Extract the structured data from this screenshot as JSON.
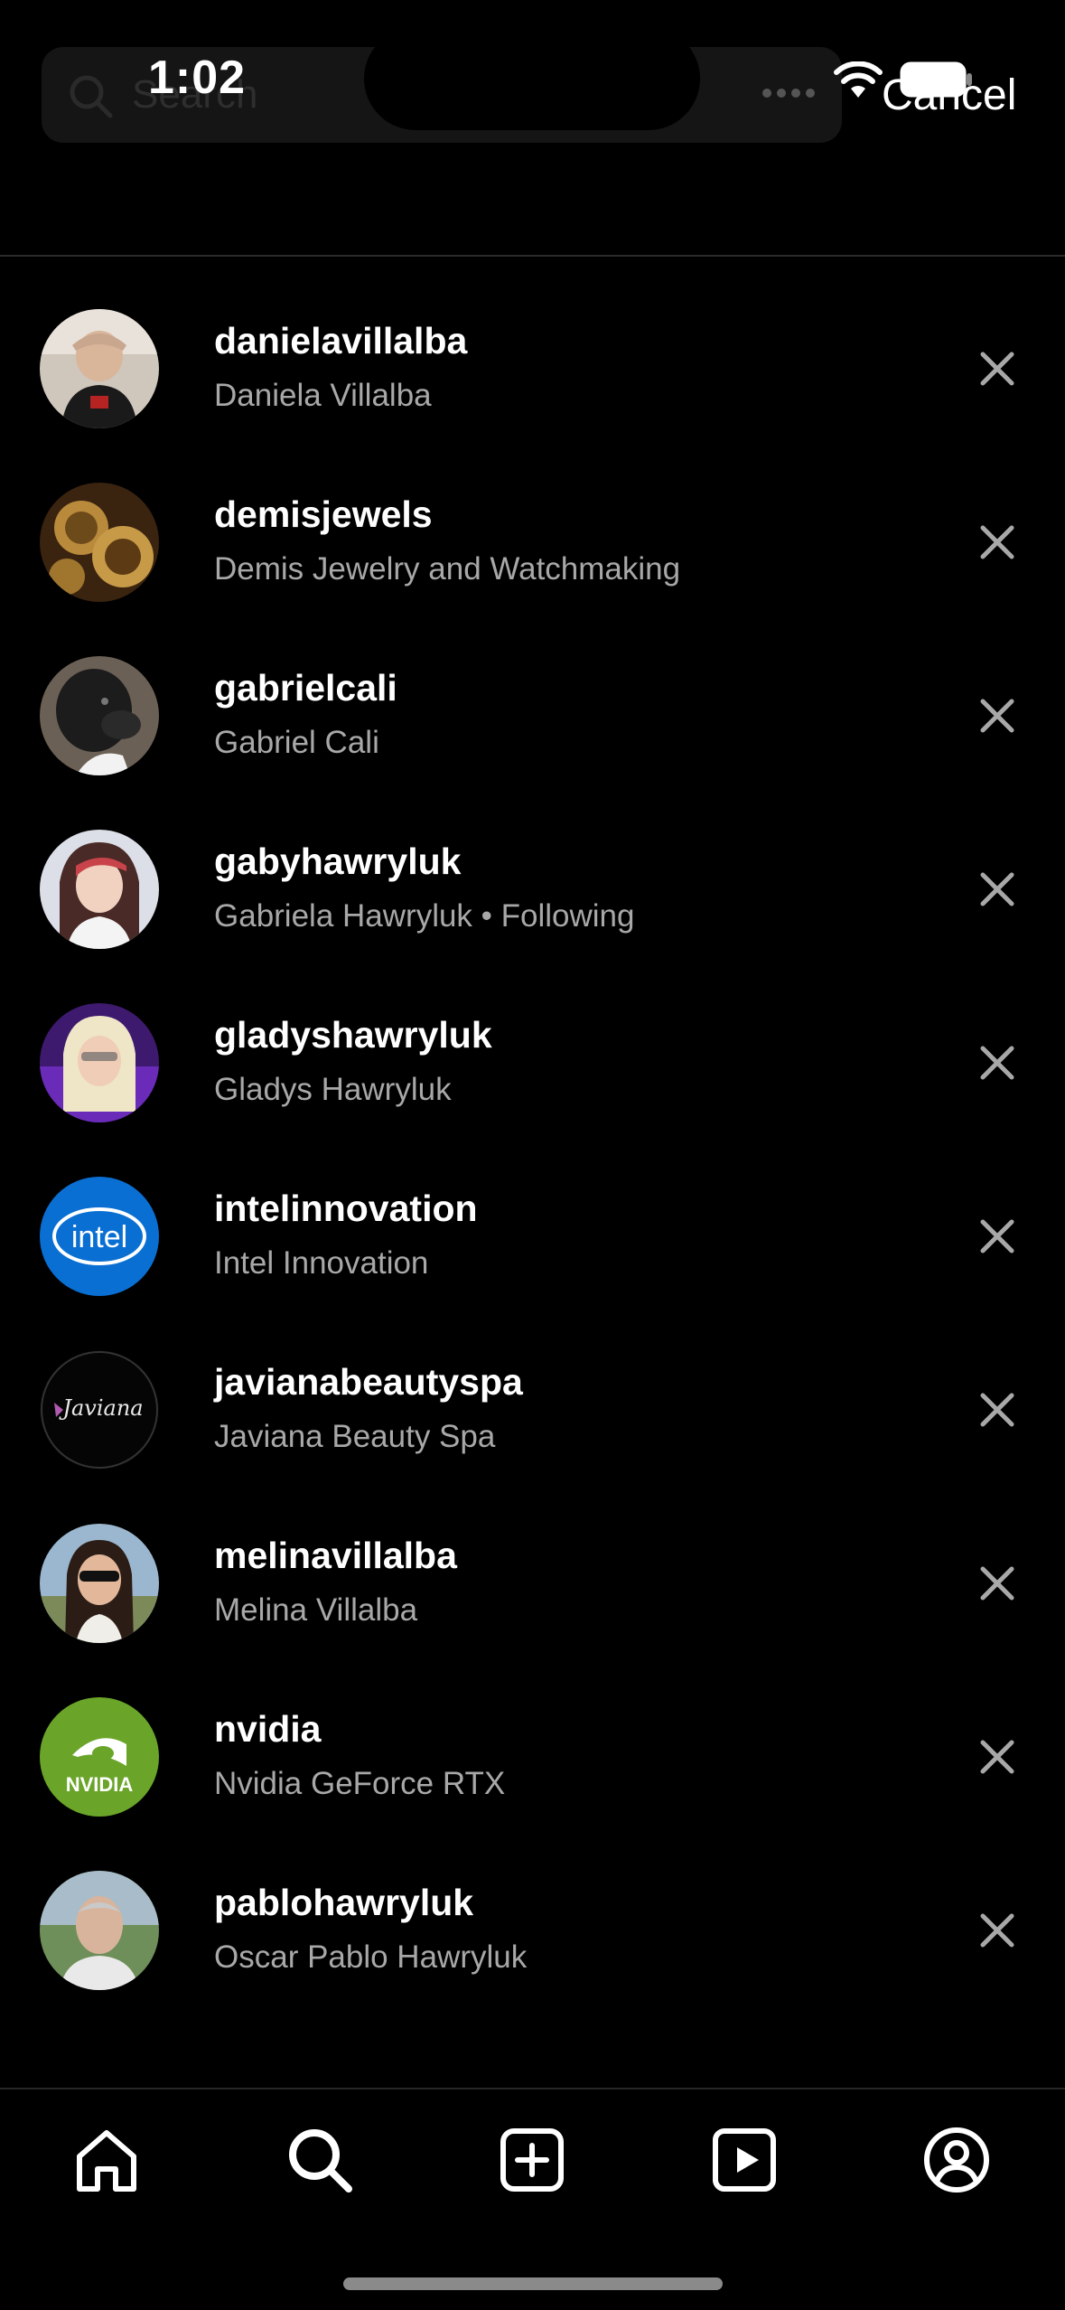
{
  "status_bar": {
    "time": "1:02"
  },
  "search": {
    "placeholder": "Search",
    "cancel_label": "Cancel"
  },
  "results": [
    {
      "username": "danielavillalba",
      "fullname": "Daniela Villalba",
      "avatar": "portrait-photo"
    },
    {
      "username": "demisjewels",
      "fullname": "Demis Jewelry and Watchmaking",
      "avatar": "watch-gears-photo"
    },
    {
      "username": "gabrielcali",
      "fullname": "Gabriel Cali",
      "avatar": "dog-photo"
    },
    {
      "username": "gabyhawryluk",
      "fullname": "Gabriela Hawryluk • Following",
      "avatar": "portrait-photo"
    },
    {
      "username": "gladyshawryluk",
      "fullname": "Gladys Hawryluk",
      "avatar": "portrait-photo"
    },
    {
      "username": "intelinnovation",
      "fullname": "Intel Innovation",
      "avatar": "intel-logo",
      "logo_text": "intel"
    },
    {
      "username": "javianabeautyspa",
      "fullname": "Javiana Beauty Spa",
      "avatar": "javiana-logo",
      "logo_text": "Javiana"
    },
    {
      "username": "melinavillalba",
      "fullname": "Melina Villalba",
      "avatar": "portrait-photo"
    },
    {
      "username": "nvidia",
      "fullname": "Nvidia GeForce RTX",
      "avatar": "nvidia-logo",
      "logo_text": "NVIDIA"
    },
    {
      "username": "pablohawryluk",
      "fullname": "Oscar Pablo Hawryluk",
      "avatar": "portrait-photo"
    }
  ],
  "tab_bar": [
    {
      "name": "home",
      "icon": "home-icon"
    },
    {
      "name": "search",
      "icon": "search-icon"
    },
    {
      "name": "create",
      "icon": "plus-square-icon"
    },
    {
      "name": "reels",
      "icon": "reels-icon"
    },
    {
      "name": "profile",
      "icon": "profile-icon"
    }
  ],
  "colors": {
    "background": "#000000",
    "text_primary": "#ffffff",
    "text_secondary": "#a8a8a8",
    "intel_blue": "#0a6fd3",
    "nvidia_green": "#6aa52a"
  }
}
